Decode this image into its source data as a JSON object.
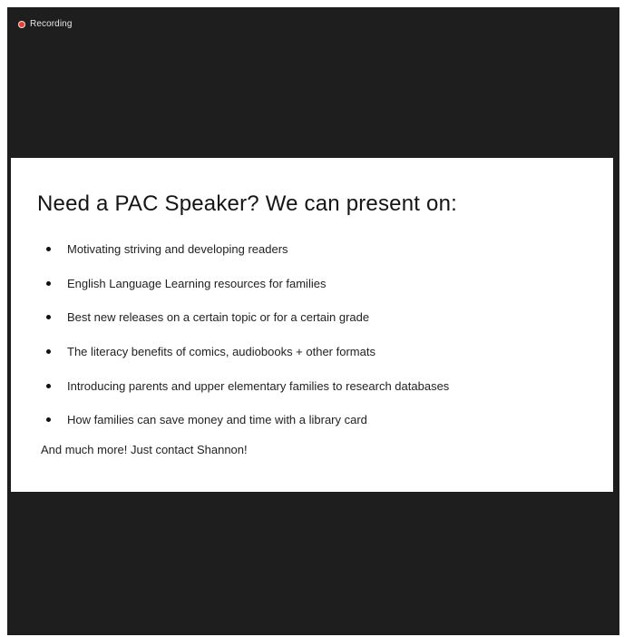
{
  "recording": {
    "label": "Recording",
    "indicator_color": "#e0413a"
  },
  "slide": {
    "title": "Need a PAC Speaker? We can present on:",
    "bullets": [
      "Motivating striving and developing readers",
      "English Language Learning resources for families",
      "Best new releases on a certain topic or for a certain grade",
      "The literacy benefits of comics, audiobooks + other formats",
      "Introducing parents and upper elementary families to research databases",
      "How families can save money and time with a library card"
    ],
    "footer": "And much more! Just contact Shannon!"
  },
  "colors": {
    "window_background": "#1e1e1e",
    "slide_background": "#ffffff",
    "text": "#111111"
  }
}
